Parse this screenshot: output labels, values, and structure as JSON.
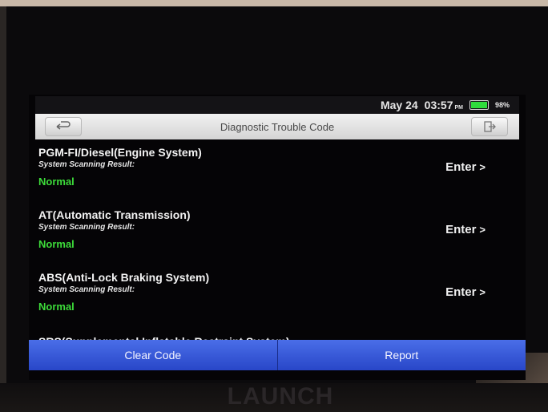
{
  "status_bar": {
    "date": "May 24",
    "time": "03:57",
    "ampm": "PM",
    "battery": "98%"
  },
  "title_bar": {
    "title": "Diagnostic Trouble Code"
  },
  "systems": [
    {
      "name": "PGM-FI/Diesel(Engine System)",
      "subtitle": "System Scanning Result:",
      "status": "Normal",
      "action": "Enter"
    },
    {
      "name": "AT(Automatic Transmission)",
      "subtitle": "System Scanning Result:",
      "status": "Normal",
      "action": "Enter"
    },
    {
      "name": "ABS(Anti-Lock Braking System)",
      "subtitle": "System Scanning Result:",
      "status": "Normal",
      "action": "Enter"
    }
  ],
  "partial_item": "SRS(Supplemental Inflatable Restraint System)",
  "bottom_bar": {
    "clear_label": "Clear Code",
    "report_label": "Report"
  },
  "brand": "LAUNCH",
  "colors": {
    "status_normal": "#3ddc3a",
    "bottom_bar": "#3557d6",
    "battery": "#2fdc3c"
  }
}
